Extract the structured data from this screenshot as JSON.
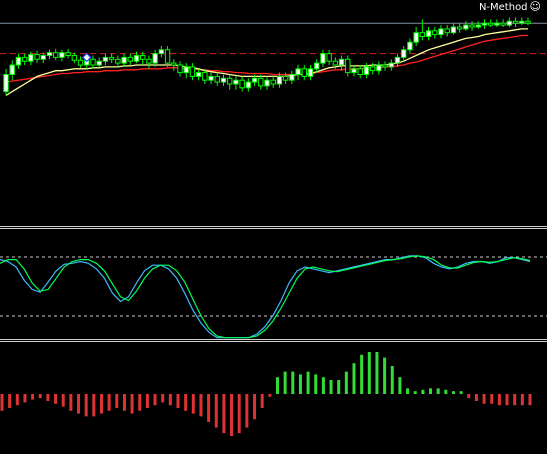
{
  "expert_advisor": {
    "name": "N-Method",
    "status_icon": "smiley-icon"
  },
  "colors": {
    "background": "#000000",
    "bull_candle": "#ffffff",
    "bear_candle": "#000000",
    "wick": "#00ff00",
    "ma_fast": "#ffff99",
    "ma_slow": "#ff2020",
    "resistance_line": "#d42020",
    "bid_line": "#8090a0",
    "stoch_main": "#3fb8ff",
    "stoch_signal": "#00ff55",
    "stoch_level": "#c8c8c8",
    "hist_positive": "#33dd33",
    "hist_negative": "#dd3333"
  },
  "price_chart": {
    "candles": [
      [
        88,
        70,
        92,
        64
      ],
      [
        70,
        60,
        76,
        55
      ],
      [
        60,
        52,
        64,
        48
      ],
      [
        52,
        56,
        60,
        48
      ],
      [
        56,
        49,
        60,
        46
      ],
      [
        49,
        54,
        58,
        45
      ],
      [
        54,
        50,
        58,
        47
      ],
      [
        50,
        47,
        54,
        44
      ],
      [
        47,
        52,
        55,
        43
      ],
      [
        52,
        47,
        56,
        44
      ],
      [
        47,
        50,
        53,
        43
      ],
      [
        50,
        55,
        58,
        47
      ],
      [
        55,
        60,
        63,
        51
      ],
      [
        60,
        54,
        64,
        50
      ],
      [
        54,
        60,
        64,
        50
      ],
      [
        60,
        56,
        64,
        52
      ],
      [
        56,
        52,
        60,
        48
      ],
      [
        52,
        54,
        58,
        48
      ],
      [
        54,
        58,
        62,
        50
      ],
      [
        58,
        52,
        62,
        48
      ],
      [
        52,
        56,
        60,
        48
      ],
      [
        56,
        50,
        58,
        46
      ],
      [
        50,
        54,
        60,
        46
      ],
      [
        54,
        58,
        64,
        50
      ],
      [
        58,
        48,
        62,
        44
      ],
      [
        48,
        44,
        52,
        40
      ],
      [
        44,
        58,
        62,
        40
      ],
      [
        58,
        60,
        66,
        54
      ],
      [
        60,
        68,
        72,
        56
      ],
      [
        68,
        62,
        74,
        58
      ],
      [
        62,
        72,
        76,
        58
      ],
      [
        72,
        68,
        76,
        64
      ],
      [
        68,
        76,
        80,
        64
      ],
      [
        76,
        72,
        80,
        68
      ],
      [
        72,
        78,
        82,
        68
      ],
      [
        78,
        74,
        82,
        70
      ],
      [
        74,
        80,
        86,
        70
      ],
      [
        80,
        76,
        86,
        72
      ],
      [
        76,
        84,
        88,
        72
      ],
      [
        84,
        78,
        88,
        74
      ],
      [
        78,
        74,
        82,
        70
      ],
      [
        74,
        82,
        86,
        70
      ],
      [
        82,
        76,
        86,
        72
      ],
      [
        76,
        80,
        84,
        72
      ],
      [
        80,
        72,
        84,
        68
      ],
      [
        72,
        76,
        80,
        68
      ],
      [
        76,
        70,
        80,
        66
      ],
      [
        70,
        64,
        76,
        60
      ],
      [
        64,
        72,
        76,
        60
      ],
      [
        72,
        64,
        76,
        60
      ],
      [
        64,
        58,
        68,
        54
      ],
      [
        58,
        48,
        62,
        44
      ],
      [
        48,
        56,
        60,
        44
      ],
      [
        56,
        60,
        64,
        52
      ],
      [
        60,
        54,
        66,
        50
      ],
      [
        54,
        68,
        72,
        50
      ],
      [
        68,
        64,
        72,
        60
      ],
      [
        64,
        70,
        74,
        60
      ],
      [
        70,
        62,
        74,
        58
      ],
      [
        62,
        66,
        70,
        58
      ],
      [
        66,
        60,
        70,
        56
      ],
      [
        60,
        62,
        66,
        56
      ],
      [
        62,
        58,
        66,
        54
      ],
      [
        58,
        52,
        62,
        48
      ],
      [
        52,
        44,
        56,
        40
      ],
      [
        44,
        36,
        48,
        32
      ],
      [
        36,
        26,
        40,
        20
      ],
      [
        26,
        30,
        34,
        12
      ],
      [
        30,
        24,
        34,
        20
      ],
      [
        24,
        28,
        32,
        20
      ],
      [
        28,
        22,
        32,
        18
      ],
      [
        22,
        26,
        30,
        18
      ],
      [
        26,
        20,
        28,
        16
      ],
      [
        20,
        22,
        26,
        16
      ],
      [
        22,
        18,
        24,
        14
      ],
      [
        18,
        20,
        24,
        14
      ],
      [
        20,
        18,
        22,
        14
      ],
      [
        18,
        16,
        22,
        12
      ],
      [
        16,
        18,
        20,
        12
      ],
      [
        18,
        16,
        20,
        12
      ],
      [
        16,
        18,
        20,
        12
      ],
      [
        18,
        14,
        20,
        10
      ],
      [
        14,
        16,
        20,
        10
      ],
      [
        16,
        14,
        18,
        10
      ],
      [
        14,
        16,
        18,
        10
      ]
    ],
    "ma_fast": [
      92,
      88,
      84,
      80,
      76,
      72,
      70,
      68,
      66,
      66,
      65,
      64,
      64,
      64,
      63,
      63,
      62,
      62,
      62,
      61,
      61,
      60,
      60,
      60,
      60,
      60,
      60,
      60,
      61,
      62,
      63,
      64,
      66,
      67,
      68,
      69,
      70,
      71,
      72,
      72,
      72,
      72,
      72,
      72,
      72,
      72,
      71,
      70,
      70,
      69,
      67,
      65,
      63,
      62,
      61,
      61,
      61,
      61,
      61,
      60,
      60,
      60,
      59,
      58,
      56,
      53,
      50,
      47,
      44,
      42,
      40,
      38,
      36,
      34,
      32,
      31,
      30,
      28,
      27,
      26,
      25,
      24,
      23,
      22,
      22
    ],
    "ma_slow": [
      78,
      77,
      76,
      75,
      74,
      73,
      72,
      71,
      70,
      69,
      69,
      68,
      68,
      67,
      67,
      67,
      66,
      66,
      66,
      65,
      65,
      65,
      64,
      64,
      64,
      64,
      63,
      63,
      63,
      64,
      64,
      65,
      65,
      66,
      66,
      67,
      67,
      68,
      68,
      69,
      69,
      69,
      69,
      70,
      70,
      70,
      70,
      70,
      69,
      69,
      68,
      67,
      66,
      65,
      65,
      64,
      64,
      64,
      63,
      63,
      63,
      62,
      62,
      61,
      60,
      58,
      57,
      55,
      53,
      51,
      49,
      47,
      45,
      43,
      41,
      39,
      37,
      35,
      34,
      33,
      32,
      31,
      30,
      29,
      29
    ],
    "resistance_price": 48,
    "bid_price": 16,
    "signal_arrow_icon": "diamond-arrow-icon"
  },
  "stochastic": {
    "main": [
      20,
      22,
      28,
      42,
      52,
      55,
      44,
      32,
      25,
      24,
      22,
      24,
      30,
      40,
      56,
      65,
      60,
      45,
      32,
      26,
      26,
      30,
      40,
      56,
      74,
      88,
      98,
      104,
      104,
      104,
      104,
      104,
      100,
      92,
      80,
      64,
      45,
      32,
      28,
      30,
      32,
      34,
      32,
      30,
      28,
      26,
      24,
      22,
      20,
      20,
      18,
      16,
      16,
      18,
      24,
      28,
      30,
      28,
      24,
      22,
      22,
      24,
      22,
      18,
      18,
      20,
      22
    ],
    "signal": [
      24,
      20,
      20,
      30,
      45,
      54,
      52,
      40,
      28,
      22,
      20,
      20,
      24,
      32,
      46,
      60,
      64,
      54,
      40,
      30,
      26,
      26,
      32,
      44,
      62,
      80,
      94,
      102,
      104,
      104,
      104,
      104,
      102,
      96,
      86,
      72,
      56,
      40,
      30,
      28,
      30,
      32,
      33,
      31,
      29,
      27,
      25,
      23,
      21,
      20,
      19,
      17,
      16,
      17,
      20,
      26,
      29,
      29,
      26,
      23,
      22,
      23,
      22,
      20,
      18,
      19,
      21
    ],
    "upper_level": 80,
    "lower_level": 20
  },
  "histogram": {
    "values": [
      -12,
      -10,
      -8,
      -6,
      -4,
      -3,
      -5,
      -7,
      -9,
      -12,
      -14,
      -16,
      -16,
      -14,
      -12,
      -10,
      -12,
      -14,
      -12,
      -10,
      -8,
      -6,
      -8,
      -10,
      -12,
      -14,
      -16,
      -20,
      -24,
      -28,
      -30,
      -28,
      -24,
      -18,
      -10,
      -2,
      12,
      16,
      16,
      14,
      16,
      14,
      12,
      10,
      10,
      16,
      22,
      28,
      30,
      30,
      26,
      20,
      12,
      4,
      2,
      3,
      4,
      4,
      3,
      2,
      2,
      -3,
      -5,
      -7,
      -7,
      -8,
      -8,
      -8,
      -8,
      -8
    ]
  }
}
